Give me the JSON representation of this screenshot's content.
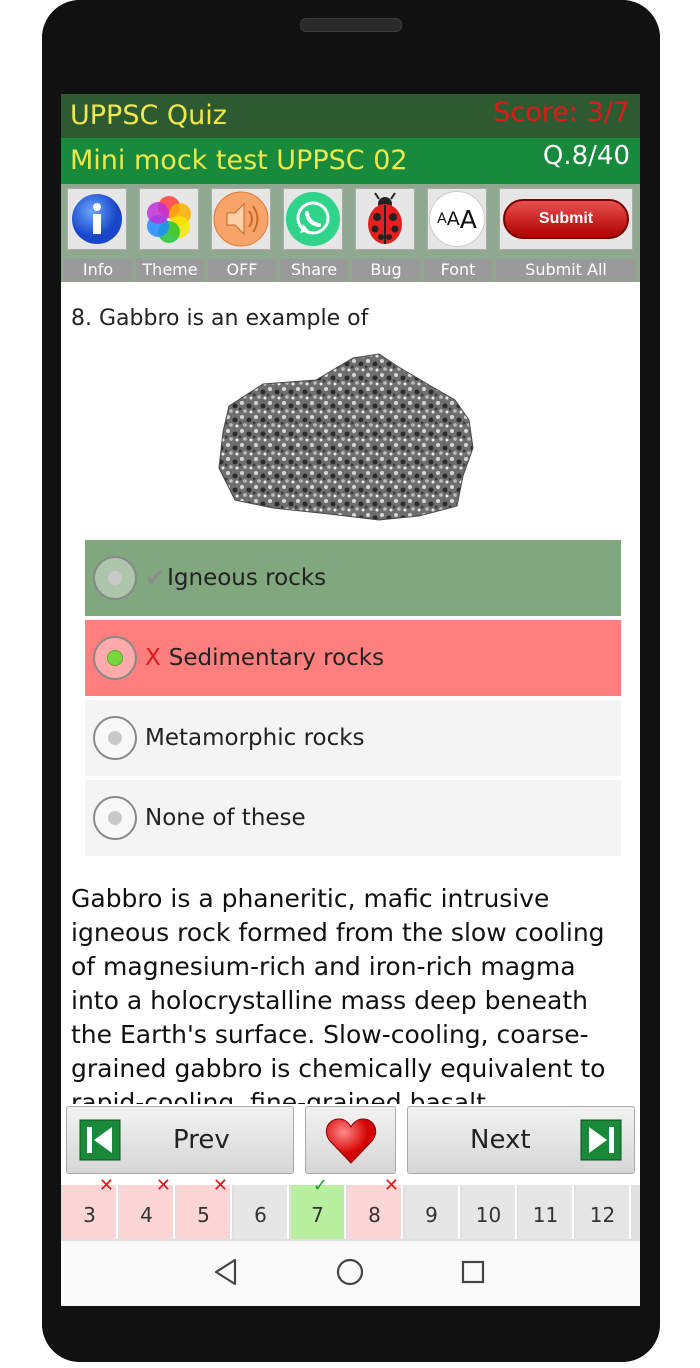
{
  "header": {
    "app_title": "UPPSC Quiz",
    "score": "Score: 3/7",
    "test_name": "Mini mock test UPPSC 02",
    "question_counter": "Q.8/40"
  },
  "toolbar": {
    "items": [
      {
        "label": "Info",
        "icon": "info-icon"
      },
      {
        "label": "Theme",
        "icon": "theme-icon"
      },
      {
        "label": "OFF",
        "icon": "speaker-icon"
      },
      {
        "label": "Share",
        "icon": "whatsapp-icon"
      },
      {
        "label": "Bug",
        "icon": "ladybug-icon"
      },
      {
        "label": "Font",
        "icon": "font-size-icon",
        "glyph": "AAA"
      }
    ],
    "submit_button": "Submit",
    "submit_all_label": "Submit All"
  },
  "question": {
    "text": "8. Gabbro is an example of",
    "image": "gabbro-rock-image"
  },
  "options": [
    {
      "label": "Igneous rocks",
      "state": "correct",
      "mark": "✔",
      "bg": "#81a77e"
    },
    {
      "label": "Sedimentary rocks",
      "state": "wrong-selected",
      "mark": "X",
      "bg": "#ff7f7f"
    },
    {
      "label": "Metamorphic rocks",
      "state": "normal",
      "mark": "",
      "bg": "#f4f4f4"
    },
    {
      "label": "None of these",
      "state": "normal",
      "mark": "",
      "bg": "#f4f4f4"
    }
  ],
  "explanation": "Gabbro is a phaneritic, mafic intrusive igneous rock formed from the slow cooling of magnesium-rich and iron-rich magma into a holocrystalline mass deep beneath the Earth's surface. Slow-cooling, coarse-grained gabbro is chemically equivalent to rapid-cooling, fine-grained basalt.",
  "nav": {
    "prev": "Prev",
    "next": "Next"
  },
  "pager": [
    {
      "n": "3",
      "status": "wrong"
    },
    {
      "n": "4",
      "status": "wrong"
    },
    {
      "n": "5",
      "status": "wrong"
    },
    {
      "n": "6",
      "status": "none"
    },
    {
      "n": "7",
      "status": "right"
    },
    {
      "n": "8",
      "status": "wrong"
    },
    {
      "n": "9",
      "status": "none"
    },
    {
      "n": "10",
      "status": "none"
    },
    {
      "n": "11",
      "status": "none"
    },
    {
      "n": "12",
      "status": "none"
    }
  ],
  "colors": {
    "header_dark": "#2e5a31",
    "header_green": "#188a3c",
    "title_yellow": "#f0e84a",
    "score_red": "#e01818",
    "correct_bg": "#81a77e",
    "wrong_bg": "#ff7f7f",
    "pager_wrong": "#fcd6d6",
    "pager_right": "#b8f0a0"
  }
}
